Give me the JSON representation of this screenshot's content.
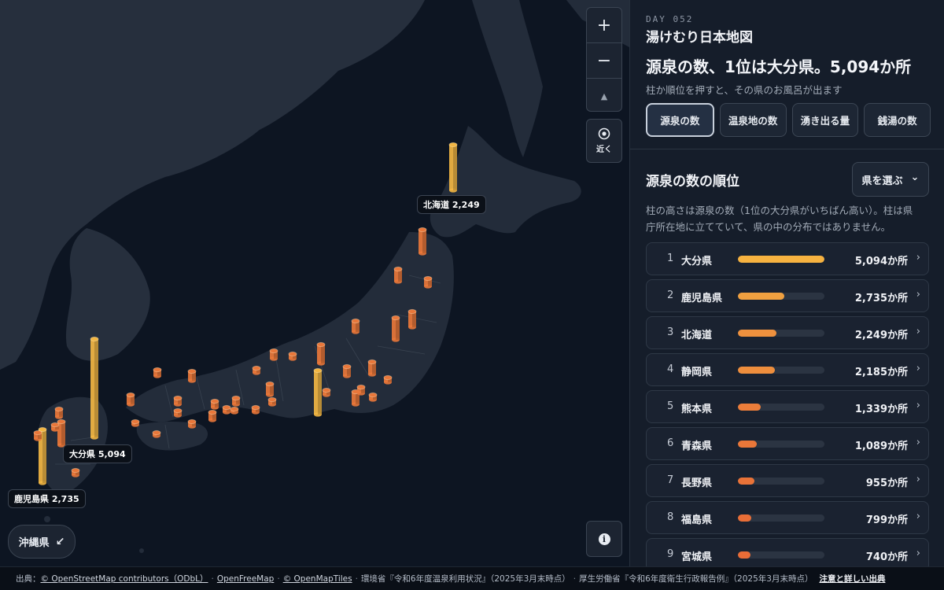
{
  "map": {
    "zoom_in": "+",
    "zoom_out": "−",
    "compass": "▲",
    "locate_label": "近く",
    "info": "i",
    "okinawa_label": "沖縄県",
    "okinawa_arrow": "↙",
    "labels": {
      "hokkaido": "北海道 2,249",
      "oita": "大分県 5,094",
      "kagoshima": "鹿児島県 2,735"
    },
    "colors": {
      "top_pillar": "#f2b643",
      "pillar": "#e9773a",
      "land": "#232c3a"
    }
  },
  "panel": {
    "day": "DAY 052",
    "title": "湯けむり日本地図",
    "headline": "源泉の数、1位は大分県。5,094か所",
    "hint": "柱か順位を押すと、その県のお風呂が出ます",
    "tabs": [
      "源泉の数",
      "温泉地の数",
      "湧き出る量",
      "銭湯の数"
    ],
    "ranking_title": "源泉の数の順位",
    "select_label": "県を選ぶ",
    "note": "柱の高さは源泉の数（1位の大分県がいちばん高い）。柱は県庁所在地に立てていて、県の中の分布ではありません。",
    "ranking": [
      {
        "rank": "1",
        "name": "大分県",
        "value": "5,094か所",
        "ratio": 1.0,
        "color": "#f6b240"
      },
      {
        "rank": "2",
        "name": "鹿児島県",
        "value": "2,735か所",
        "ratio": 0.537,
        "color": "#f0a040"
      },
      {
        "rank": "3",
        "name": "北海道",
        "value": "2,249か所",
        "ratio": 0.441,
        "color": "#ee913e"
      },
      {
        "rank": "4",
        "name": "静岡県",
        "value": "2,185か所",
        "ratio": 0.429,
        "color": "#ee8e3d"
      },
      {
        "rank": "5",
        "name": "熊本県",
        "value": "1,339か所",
        "ratio": 0.263,
        "color": "#eb7d3a"
      },
      {
        "rank": "6",
        "name": "青森県",
        "value": "1,089か所",
        "ratio": 0.214,
        "color": "#ea7739"
      },
      {
        "rank": "7",
        "name": "長野県",
        "value": "955か所",
        "ratio": 0.187,
        "color": "#e97338"
      },
      {
        "rank": "8",
        "name": "福島県",
        "value": "799か所",
        "ratio": 0.157,
        "color": "#e86e37"
      },
      {
        "rank": "9",
        "name": "宮城県",
        "value": "740か所",
        "ratio": 0.145,
        "color": "#e86c37"
      }
    ],
    "chevron": "›",
    "select_chevron": "⌄"
  },
  "footer": {
    "prefix": "出典：",
    "src1": "© OpenStreetMap contributors（ODbL）",
    "src2": "OpenFreeMap",
    "src3": "© OpenMapTiles",
    "src4": "環境省『令和6年度温泉利用状況』（2025年3月末時点）",
    "src5": "厚生労働省『令和6年度衛生行政報告例』（2025年3月末時点）",
    "more": "注意と詳しい出典",
    "dot": "·"
  }
}
